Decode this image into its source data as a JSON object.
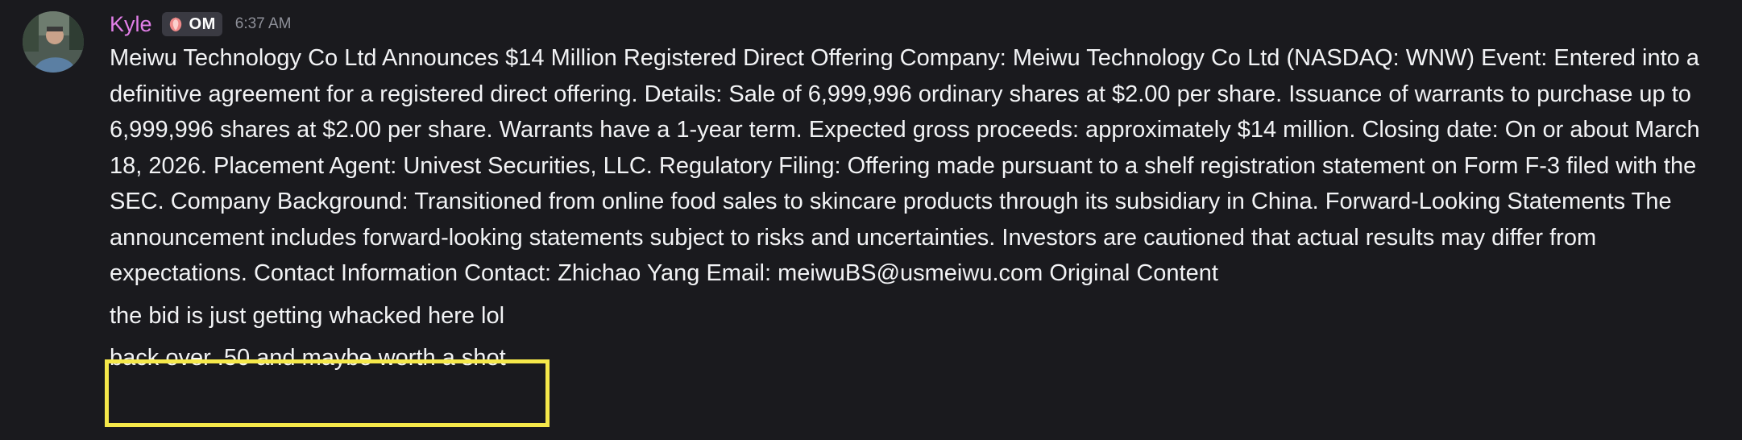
{
  "header": {
    "username": "Kyle",
    "tag_label": "OM",
    "timestamp": "6:37 AM"
  },
  "messages": [
    {
      "text": "Meiwu Technology Co Ltd Announces $14 Million Registered Direct Offering Company: Meiwu Technology Co Ltd (NASDAQ: WNW) Event: Entered into a definitive agreement for a registered direct offering. Details: Sale of 6,999,996 ordinary shares at $2.00 per share. Issuance of warrants to purchase up to 6,999,996 shares at $2.00 per share. Warrants have a 1-year term. Expected gross proceeds: approximately $14 million. Closing date: On or about March 18, 2026. Placement Agent: Univest Securities, LLC. Regulatory Filing: Offering made pursuant to a shelf registration statement on Form F-3 filed with the SEC. Company Background: Transitioned from online food sales to skincare products through its subsidiary in China. Forward-Looking Statements The announcement includes forward-looking statements subject to risks and uncertainties. Investors are cautioned that actual results may differ from expectations. Contact Information Contact: Zhichao Yang Email: meiwuBS@usmeiwu.com Original Content"
    },
    {
      "text": "the bid is just getting whacked here lol"
    },
    {
      "text": "back over .50 and maybe worth a shot"
    }
  ],
  "colors": {
    "background": "#1a1a1e",
    "username": "#e27fe8",
    "timestamp": "#8e9099",
    "highlight": "#f5e84a",
    "tag_background": "#3a3a42"
  },
  "icons": {
    "avatar": "user-avatar-photo",
    "tag_icon": "peach-badge-icon"
  }
}
